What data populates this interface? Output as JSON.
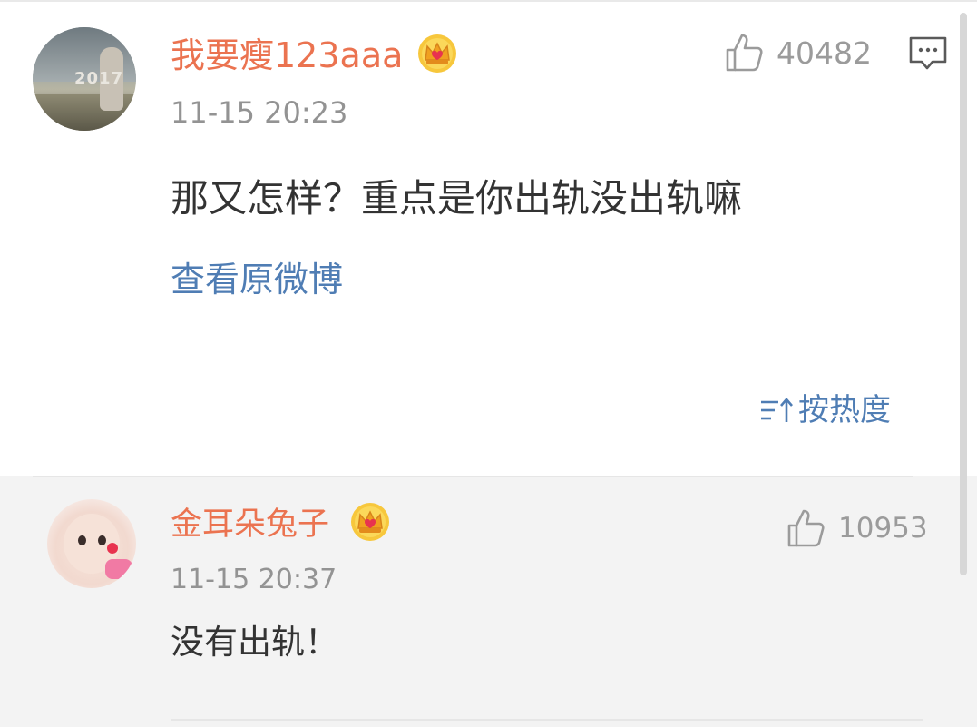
{
  "comment": {
    "username": "我要瘦123aaa",
    "timestamp": "11-15 20:23",
    "text": "那又怎样？重点是你出轨没出轨嘛",
    "likes": "40482",
    "view_original_label": "查看原微博",
    "badge_icon": "crown-badge-icon",
    "like_icon": "thumbs-up-icon",
    "comment_icon": "comment-icon"
  },
  "sort": {
    "label": "按热度",
    "icon": "sort-icon"
  },
  "reply": {
    "username": "金耳朵兔子",
    "timestamp": "11-15 20:37",
    "text": "没有出轨！",
    "likes": "10953",
    "badge_icon": "crown-badge-icon",
    "like_icon": "thumbs-up-icon"
  },
  "colors": {
    "username": "#eb7350",
    "link": "#4f7db4",
    "text": "#333333",
    "meta": "#939393",
    "reply_background": "#f3f3f3"
  }
}
